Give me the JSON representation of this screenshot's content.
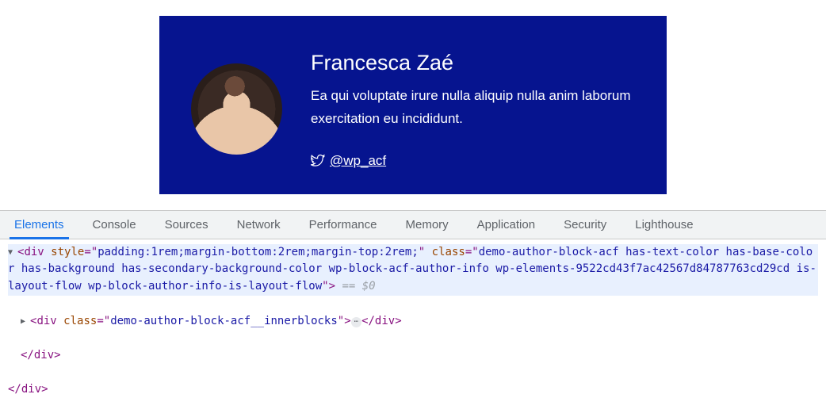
{
  "preview": {
    "author_name": "Francesca Zaé",
    "bio": "Ea qui voluptate irure nulla aliquip nulla anim laborum exercitation eu incididunt.",
    "twitter_handle": "@wp_acf"
  },
  "devtools": {
    "tabs": [
      "Elements",
      "Console",
      "Sources",
      "Network",
      "Performance",
      "Memory",
      "Application",
      "Security",
      "Lighthouse"
    ],
    "active_tab": 0,
    "dom": {
      "outer_open_tag": "div",
      "outer_style_attr": "style",
      "outer_style_val": "padding:1rem;margin-bottom:2rem;margin-top:2rem;",
      "outer_class_attr": "class",
      "outer_class_val": "demo-author-block-acf has-text-color has-base-color has-background has-secondary-background-color wp-block-acf-author-info wp-elements-9522cd43f7ac42567d84787763cd29cd is-layout-flow wp-block-author-info-is-layout-flow",
      "selected_marker": " == $0",
      "inner_open_tag": "div",
      "inner_class_attr": "class",
      "inner_class_val": "demo-author-block-acf__innerblocks",
      "close_div_1": "</div>",
      "close_div_2": "</div>",
      "close_div_3": "</div>"
    }
  }
}
